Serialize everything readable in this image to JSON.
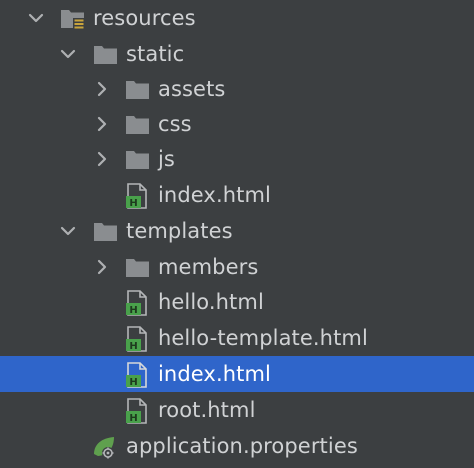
{
  "tree": {
    "resources": {
      "label": "resources"
    },
    "static": {
      "label": "static"
    },
    "assets": {
      "label": "assets"
    },
    "css": {
      "label": "css"
    },
    "js": {
      "label": "js"
    },
    "static_index": {
      "label": "index.html"
    },
    "templates": {
      "label": "templates"
    },
    "members": {
      "label": "members"
    },
    "hello": {
      "label": "hello.html"
    },
    "hello_template": {
      "label": "hello-template.html"
    },
    "templates_index": {
      "label": "index.html",
      "selected": true
    },
    "root": {
      "label": "root.html"
    },
    "application_properties": {
      "label": "application.properties"
    }
  },
  "colors": {
    "background": "#3c3f41",
    "selection": "#2f65ca",
    "text": "#d0d2d4",
    "folder": "#8a8d90",
    "html_badge": "#49a14b",
    "resources_badge": "#c9a43c",
    "spring_leaf": "#5fa04e"
  }
}
